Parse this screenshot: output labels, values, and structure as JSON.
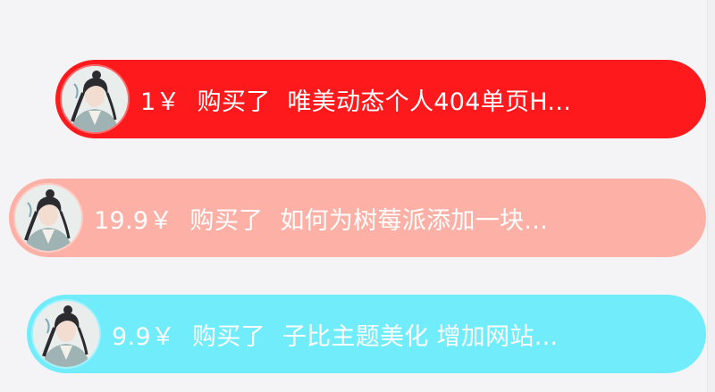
{
  "purchases": [
    {
      "price": "1￥",
      "action": "购买了",
      "product": "唯美动态个人404单页H...",
      "color": "#fe1a1c",
      "avatar_icon": "user-avatar-icon"
    },
    {
      "price": "19.9￥",
      "action": "购买了",
      "product": "如何为树莓派添加一块...",
      "color": "#fdb1a6",
      "avatar_icon": "user-avatar-icon"
    },
    {
      "price": "9.9￥",
      "action": "购买了",
      "product": "子比主题美化 增加网站...",
      "color": "#70ecfa",
      "avatar_icon": "user-avatar-icon"
    }
  ]
}
